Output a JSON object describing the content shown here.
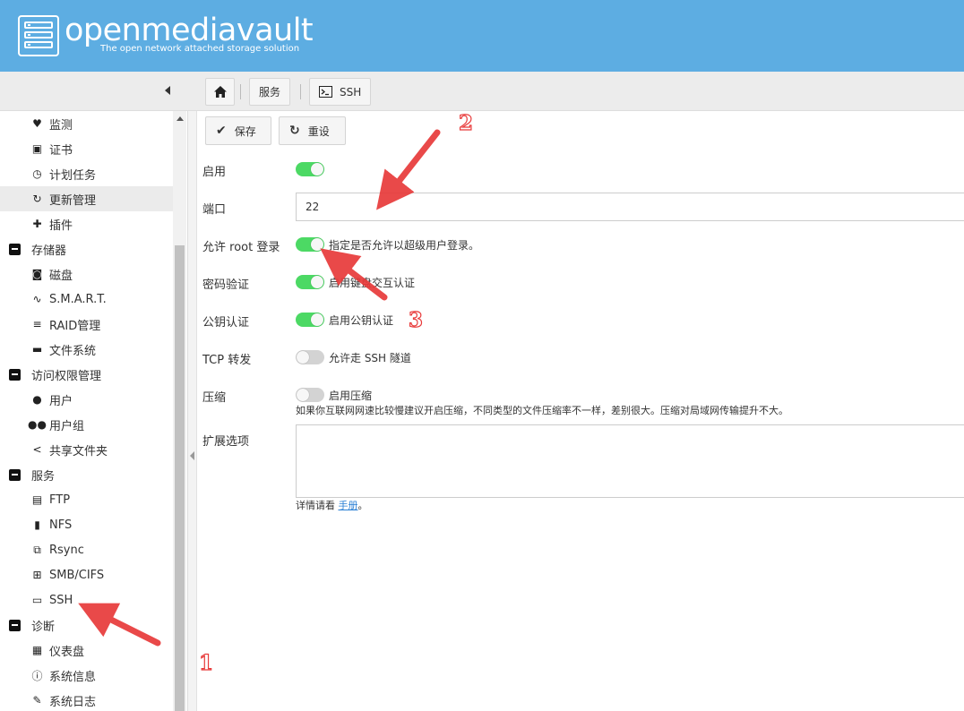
{
  "header": {
    "brand": "openmediavault",
    "tagline": "The open network attached storage solution"
  },
  "breadcrumb": {
    "home_icon": "home-icon",
    "items": [
      "服务",
      "SSH"
    ]
  },
  "sidebar": {
    "items": [
      {
        "label": "监测",
        "icon": "heart-pulse-icon",
        "type": "child"
      },
      {
        "label": "证书",
        "icon": "certificate-icon",
        "type": "child"
      },
      {
        "label": "计划任务",
        "icon": "calendar-clock-icon",
        "type": "child"
      },
      {
        "label": "更新管理",
        "icon": "refresh-icon",
        "type": "child",
        "active": true
      },
      {
        "label": "插件",
        "icon": "puzzle-icon",
        "type": "child"
      },
      {
        "label": "存储器",
        "icon": "minus-box-icon",
        "type": "group"
      },
      {
        "label": "磁盘",
        "icon": "harddisk-icon",
        "type": "child"
      },
      {
        "label": "S.M.A.R.T.",
        "icon": "pulse-icon",
        "type": "child"
      },
      {
        "label": "RAID管理",
        "icon": "database-icon",
        "type": "child"
      },
      {
        "label": "文件系统",
        "icon": "folder-icon",
        "type": "child"
      },
      {
        "label": "访问权限管理",
        "icon": "minus-box-icon",
        "type": "group"
      },
      {
        "label": "用户",
        "icon": "user-icon",
        "type": "child"
      },
      {
        "label": "用户组",
        "icon": "users-icon",
        "type": "child"
      },
      {
        "label": "共享文件夹",
        "icon": "share-icon",
        "type": "child"
      },
      {
        "label": "服务",
        "icon": "minus-box-icon",
        "type": "group"
      },
      {
        "label": "FTP",
        "icon": "server-icon",
        "type": "child"
      },
      {
        "label": "NFS",
        "icon": "nfs-icon",
        "type": "child"
      },
      {
        "label": "Rsync",
        "icon": "rsync-icon",
        "type": "child"
      },
      {
        "label": "SMB/CIFS",
        "icon": "windows-icon",
        "type": "child"
      },
      {
        "label": "SSH",
        "icon": "console-icon",
        "type": "child"
      },
      {
        "label": "诊断",
        "icon": "minus-box-icon",
        "type": "group"
      },
      {
        "label": "仪表盘",
        "icon": "dashboard-icon",
        "type": "child"
      },
      {
        "label": "系统信息",
        "icon": "info-icon",
        "type": "child"
      },
      {
        "label": "系统日志",
        "icon": "log-icon",
        "type": "child"
      }
    ]
  },
  "toolbar": {
    "save_label": "保存",
    "reset_label": "重设"
  },
  "form": {
    "enabled": {
      "label": "启用",
      "value": true
    },
    "port": {
      "label": "端口",
      "value": "22"
    },
    "root_login": {
      "label": "允许 root 登录",
      "value": true,
      "hint": "指定是否允许以超级用户登录。"
    },
    "password_auth": {
      "label": "密码验证",
      "value": true,
      "hint": "启用键盘交互认证"
    },
    "pubkey_auth": {
      "label": "公钥认证",
      "value": true,
      "hint": "启用公钥认证"
    },
    "tcp_forward": {
      "label": "TCP 转发",
      "value": false,
      "hint": "允许走 SSH 隧道"
    },
    "compression": {
      "label": "压缩",
      "value": false,
      "hint": "启用压缩",
      "note": "如果你互联网网速比较慢建议开启压缩，不同类型的文件压缩率不一样，差别很大。压缩对局域网传输提升不大。"
    },
    "extra_options": {
      "label": "扩展选项",
      "note_prefix": "详情请看",
      "note_link": "手册",
      "note_suffix": "。"
    }
  },
  "annotations": {
    "n1": "1",
    "n2": "2",
    "n3": "3"
  },
  "colors": {
    "header": "#5dade2",
    "toggle_on": "#4cd964",
    "arrow": "#e83a3a"
  }
}
